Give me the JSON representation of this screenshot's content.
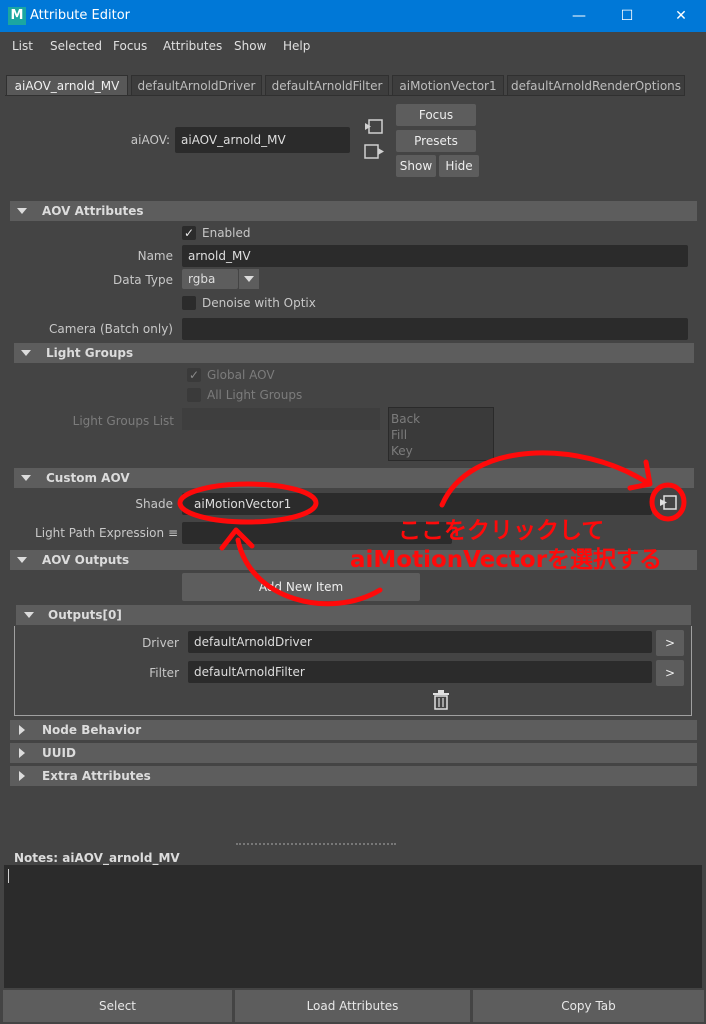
{
  "window": {
    "app_icon": "M",
    "title": "Attribute Editor",
    "minimize": "—",
    "maximize": "☐",
    "close": "✕"
  },
  "menu": [
    "List",
    "Selected",
    "Focus",
    "Attributes",
    "Show",
    "Help"
  ],
  "tabs": [
    {
      "label": "aiAOV_arnold_MV",
      "active": true
    },
    {
      "label": "defaultArnoldDriver",
      "active": false
    },
    {
      "label": "defaultArnoldFilter",
      "active": false
    },
    {
      "label": "aiMotionVector1",
      "active": false
    },
    {
      "label": "defaultArnoldRenderOptions",
      "active": false
    }
  ],
  "header": {
    "node_label": "aiAOV:",
    "node_value": "aiAOV_arnold_MV",
    "focus": "Focus",
    "presets": "Presets",
    "show": "Show",
    "hide": "Hide"
  },
  "aov_attributes": {
    "title": "AOV Attributes",
    "enabled_label": "Enabled",
    "enabled": true,
    "name_label": "Name",
    "name_value": "arnold_MV",
    "data_type_label": "Data Type",
    "data_type_value": "rgba",
    "denoise_label": "Denoise with Optix",
    "denoise": false,
    "camera_label": "Camera (Batch only)",
    "camera_value": ""
  },
  "light_groups": {
    "title": "Light Groups",
    "global_aov_label": "Global AOV",
    "global_aov": true,
    "all_light_groups_label": "All Light Groups",
    "all_light_groups": false,
    "list_label": "Light Groups List",
    "list_items": [
      "Back",
      "Fill",
      "Key"
    ]
  },
  "custom_aov": {
    "title": "Custom AOV",
    "shader_label": "Shade",
    "shader_value": "aiMotionVector1",
    "lpe_label": "Light Path Expression ≡",
    "lpe_value": ""
  },
  "aov_outputs": {
    "title": "AOV Outputs",
    "add_new_item": "Add New Item",
    "outputs_title": "Outputs[0]",
    "driver_label": "Driver",
    "driver_value": "defaultArnoldDriver",
    "filter_label": "Filter",
    "filter_value": "defaultArnoldFilter",
    "nav_button": ">"
  },
  "collapsed_sections": [
    "Node Behavior",
    "UUID",
    "Extra Attributes"
  ],
  "notes": {
    "label": "Notes:  aiAOV_arnold_MV",
    "value": ""
  },
  "bottom_buttons": [
    "Select",
    "Load Attributes",
    "Copy Tab"
  ],
  "annotation": {
    "line1": "ここをクリックして",
    "line2": "aiMotionVectorを選択する",
    "color": "#ff0a0a"
  }
}
